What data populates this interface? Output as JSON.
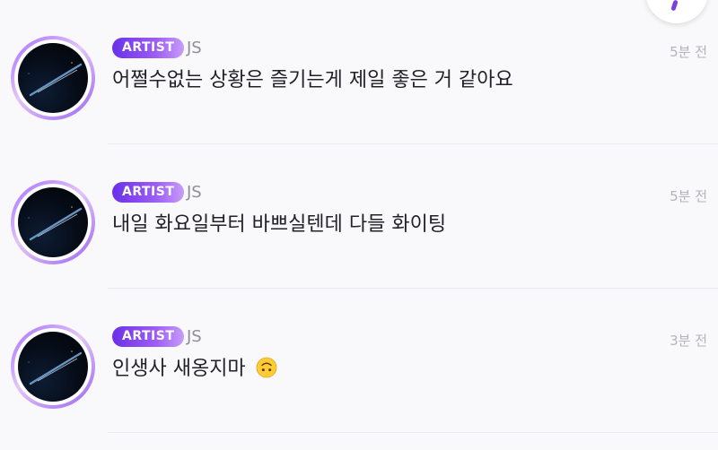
{
  "posts": [
    {
      "badge": "ARTIST",
      "author": "JS",
      "time": "5분 전",
      "message": "어쩔수없는 상황은 즐기는게 제일 좋은 거 같아요",
      "emoji": ""
    },
    {
      "badge": "ARTIST",
      "author": "JS",
      "time": "5분 전",
      "message": "내일 화요일부터 바쁘실텐데 다들 화이팅",
      "emoji": ""
    },
    {
      "badge": "ARTIST",
      "author": "JS",
      "time": "3분 전",
      "message": "인생사 새옹지마",
      "emoji": "upside-down-face-icon"
    }
  ]
}
